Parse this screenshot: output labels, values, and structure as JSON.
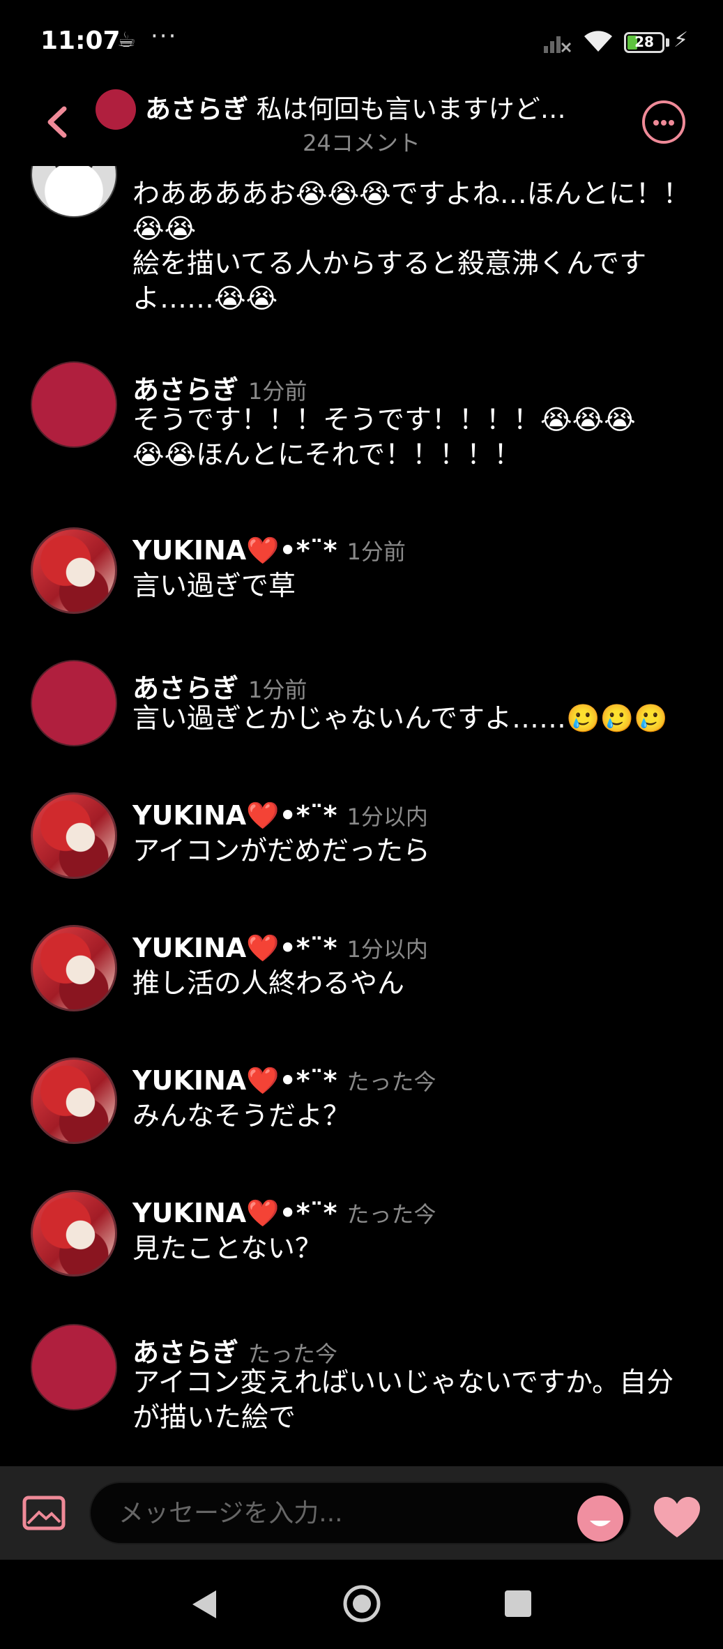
{
  "status_bar": {
    "time": "11:07",
    "battery": "28"
  },
  "header": {
    "author": "あさらぎ",
    "title": "私は何回も言いますけど…",
    "comment_count": "24コメント"
  },
  "comments": [
    {
      "avatar": "sketch",
      "name": "",
      "time": "",
      "text": "わああああお😭😭😭ですよね…ほんとに！！😭😭\n絵を描いてる人からすると殺意沸くんですよ……😭😭"
    },
    {
      "avatar": "plain",
      "name": "あさらぎ",
      "time": "1分前",
      "text": "そうです！！！そうです！！！！😭😭😭\n😭😭ほんとにそれで！！！！！"
    },
    {
      "avatar": "art",
      "name": "YUKINA❤️•*¨*",
      "time": "1分前",
      "text": "言い過ぎで草"
    },
    {
      "avatar": "plain",
      "name": "あさらぎ",
      "time": "1分前",
      "text": "言い過ぎとかじゃないんですよ……🥲🥲🥲"
    },
    {
      "avatar": "art",
      "name": "YUKINA❤️•*¨*",
      "time": "1分以内",
      "text": "アイコンがだめだったら"
    },
    {
      "avatar": "art",
      "name": "YUKINA❤️•*¨*",
      "time": "1分以内",
      "text": "推し活の人終わるやん"
    },
    {
      "avatar": "art",
      "name": "YUKINA❤️•*¨*",
      "time": "たった今",
      "text": "みんなそうだよ？"
    },
    {
      "avatar": "art",
      "name": "YUKINA❤️•*¨*",
      "time": "たった今",
      "text": "見たことない？"
    },
    {
      "avatar": "plain",
      "name": "あさらぎ",
      "time": "たった今",
      "text": "アイコン変えればいいじゃないですか。自分が描いた絵で"
    }
  ],
  "input": {
    "placeholder": "メッセージを入力..."
  },
  "colors": {
    "accent": "#ef8a98",
    "avatar_red": "#b01f3e",
    "background": "#000000"
  }
}
